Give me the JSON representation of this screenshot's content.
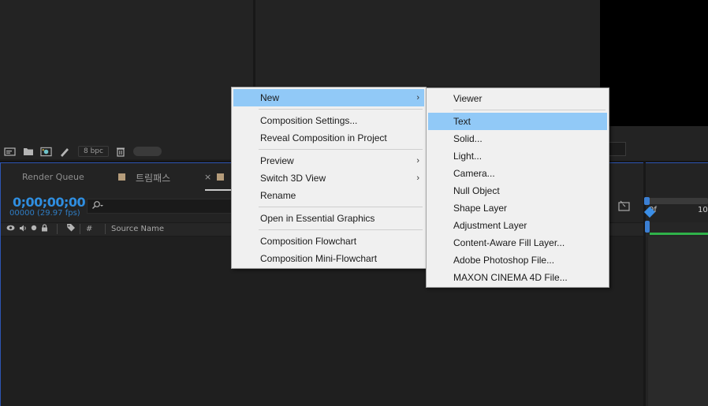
{
  "project_toolbar": {
    "icons": [
      "interpret-footage-icon",
      "new-folder-icon",
      "new-composition-icon",
      "pen-tool-icon",
      "trash-icon"
    ],
    "bpc_label": "8 bpc"
  },
  "timeline": {
    "tabs": [
      {
        "label": "Render Queue"
      },
      {
        "label": "트림패스"
      },
      {
        "close": "×"
      }
    ],
    "timecode": "0;00;00;00",
    "timecode_sub": "00000 (29.97 fps)",
    "search_placeholder": "",
    "columns": {
      "hash": "#",
      "source_name": "Source Name"
    },
    "ruler": {
      "start_label": "0f",
      "next_label": "10"
    }
  },
  "main_menu": {
    "items": [
      {
        "label": "New",
        "submenu": true,
        "highlighted": true
      },
      {
        "separator": true
      },
      {
        "label": "Composition Settings..."
      },
      {
        "label": "Reveal Composition in Project"
      },
      {
        "separator": true
      },
      {
        "label": "Preview",
        "submenu": true
      },
      {
        "label": "Switch 3D View",
        "submenu": true
      },
      {
        "label": "Rename"
      },
      {
        "separator": true
      },
      {
        "label": "Open in Essential Graphics"
      },
      {
        "separator": true
      },
      {
        "label": "Composition Flowchart"
      },
      {
        "label": "Composition Mini-Flowchart"
      }
    ],
    "arrow": "›"
  },
  "sub_menu": {
    "items": [
      {
        "label": "Viewer"
      },
      {
        "separator": true
      },
      {
        "label": "Text",
        "highlighted": true
      },
      {
        "label": "Solid..."
      },
      {
        "label": "Light..."
      },
      {
        "label": "Camera..."
      },
      {
        "label": "Null Object"
      },
      {
        "label": "Shape Layer"
      },
      {
        "label": "Adjustment Layer"
      },
      {
        "label": "Content-Aware Fill Layer..."
      },
      {
        "label": "Adobe Photoshop File..."
      },
      {
        "label": "MAXON CINEMA 4D File..."
      }
    ]
  },
  "colors": {
    "accent_blue": "#2f8ee0",
    "menu_highlight": "#91c9f7",
    "label_tan": "#b59c7a",
    "work_area_green": "#2fb24a"
  }
}
